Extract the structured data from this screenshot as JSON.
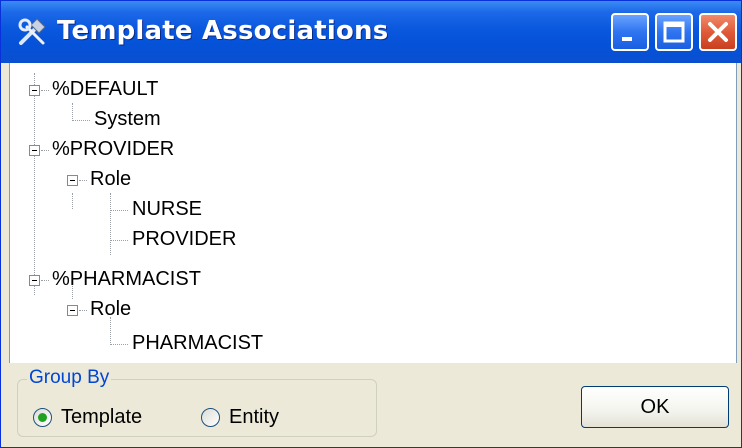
{
  "window": {
    "title": "Template Associations",
    "icon": "tools-icon",
    "controls": [
      "minimize-icon",
      "maximize-icon",
      "close-icon"
    ]
  },
  "tree": {
    "nodes": [
      {
        "label": "%DEFAULT",
        "level": 0,
        "expanded": true
      },
      {
        "label": "System",
        "level": 1
      },
      {
        "label": "%PROVIDER",
        "level": 0,
        "expanded": true
      },
      {
        "label": "Role",
        "level": 1,
        "expanded": true
      },
      {
        "label": "NURSE",
        "level": 2
      },
      {
        "label": "PROVIDER",
        "level": 2
      },
      {
        "label": "%PHARMACIST",
        "level": 0,
        "expanded": true
      },
      {
        "label": "Role",
        "level": 1,
        "expanded": true
      },
      {
        "label": "PHARMACIST",
        "level": 2
      }
    ]
  },
  "group_by": {
    "label": "Group By",
    "options": [
      {
        "label": "Template",
        "checked": true
      },
      {
        "label": "Entity",
        "checked": false
      }
    ]
  },
  "buttons": {
    "ok": "OK"
  },
  "colors": {
    "titlebar": "#0a58de",
    "group_label": "#0046d5",
    "radio_dot": "#21a121",
    "dialog_bg": "#ece9d8"
  }
}
